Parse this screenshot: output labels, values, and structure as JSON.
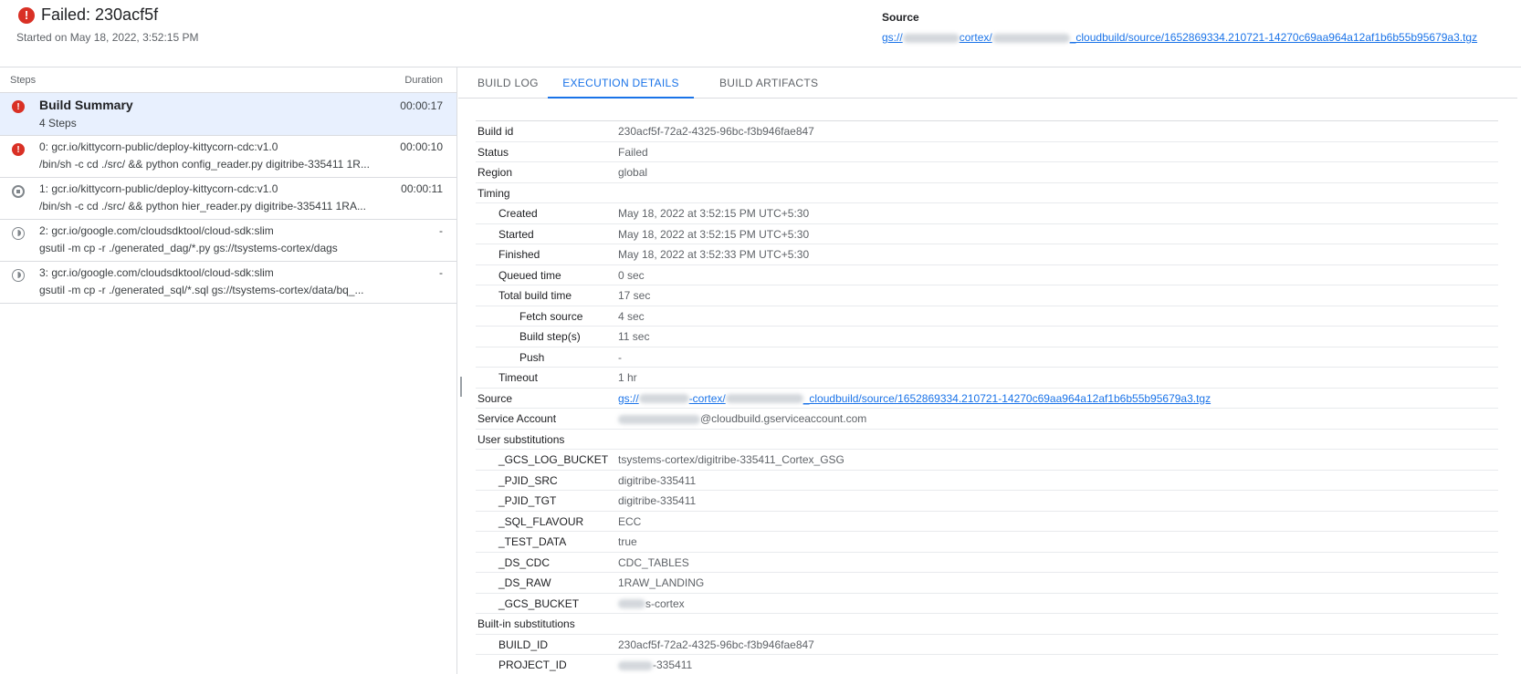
{
  "header": {
    "title": "Failed: 230acf5f",
    "started": "Started on May 18, 2022, 3:52:15 PM",
    "source_label": "Source",
    "source_link_prefix": "gs://",
    "source_link_mid": "cortex/",
    "source_link_tail": "_cloudbuild/source/1652869334.210721-14270c69aa964a12af1b6b55b95679a3.tgz"
  },
  "steps_panel": {
    "col_steps": "Steps",
    "col_duration": "Duration",
    "steps": [
      {
        "title": "Build Summary",
        "subtitle": "4 Steps",
        "duration": "00:00:17",
        "status": "error"
      },
      {
        "title": "0: gcr.io/kittycorn-public/deploy-kittycorn-cdc:v1.0",
        "subtitle": "/bin/sh -c cd ./src/ && python config_reader.py digitribe-335411 1R...",
        "duration": "00:00:10",
        "status": "error"
      },
      {
        "title": "1: gcr.io/kittycorn-public/deploy-kittycorn-cdc:v1.0",
        "subtitle": "/bin/sh -c cd ./src/ && python hier_reader.py digitribe-335411 1RA...",
        "duration": "00:00:11",
        "status": "cancelled"
      },
      {
        "title": "2: gcr.io/google.com/cloudsdktool/cloud-sdk:slim",
        "subtitle": "gsutil -m cp -r ./generated_dag/*.py gs://tsystems-cortex/dags",
        "duration": "-",
        "status": "pending"
      },
      {
        "title": "3: gcr.io/google.com/cloudsdktool/cloud-sdk:slim",
        "subtitle": "gsutil -m cp -r ./generated_sql/*.sql gs://tsystems-cortex/data/bq_...",
        "duration": "-",
        "status": "pending"
      }
    ]
  },
  "tabs": [
    "BUILD LOG",
    "EXECUTION DETAILS",
    "BUILD ARTIFACTS"
  ],
  "details": [
    {
      "k": "Build id",
      "v": "230acf5f-72a2-4325-96bc-f3b946fae847",
      "level": 0
    },
    {
      "k": "Status",
      "v": "Failed",
      "level": 0
    },
    {
      "k": "Region",
      "v": "global",
      "level": 0
    },
    {
      "k": "Timing",
      "v": "",
      "level": 0
    },
    {
      "k": "Created",
      "v": "May 18, 2022 at 3:52:15 PM UTC+5:30",
      "level": 1
    },
    {
      "k": "Started",
      "v": "May 18, 2022 at 3:52:15 PM UTC+5:30",
      "level": 1
    },
    {
      "k": "Finished",
      "v": "May 18, 2022 at 3:52:33 PM UTC+5:30",
      "level": 1
    },
    {
      "k": "Queued time",
      "v": "0 sec",
      "level": 1
    },
    {
      "k": "Total build time",
      "v": "17 sec",
      "level": 1
    },
    {
      "k": "Fetch source",
      "v": "4 sec",
      "level": 2
    },
    {
      "k": "Build step(s)",
      "v": "11 sec",
      "level": 2
    },
    {
      "k": "Push",
      "v": "-",
      "level": 2
    },
    {
      "k": "Timeout",
      "v": "1 hr",
      "level": 1
    },
    {
      "k": "Source",
      "v": "_cloudbuild/source/1652869334.210721-14270c69aa964a12af1b6b55b95679a3.tgz",
      "level": 0,
      "link": true
    },
    {
      "k": "Service Account",
      "v": "@cloudbuild.gserviceaccount.com",
      "level": 0,
      "redacted": true
    },
    {
      "k": "User substitutions",
      "v": "",
      "level": 0
    },
    {
      "k": "_GCS_LOG_BUCKET",
      "v": "tsystems-cortex/digitribe-335411_Cortex_GSG",
      "level": 1
    },
    {
      "k": "_PJID_SRC",
      "v": "digitribe-335411",
      "level": 1
    },
    {
      "k": "_PJID_TGT",
      "v": "digitribe-335411",
      "level": 1
    },
    {
      "k": "_SQL_FLAVOUR",
      "v": "ECC",
      "level": 1
    },
    {
      "k": "_TEST_DATA",
      "v": "true",
      "level": 1
    },
    {
      "k": "_DS_CDC",
      "v": "CDC_TABLES",
      "level": 1
    },
    {
      "k": "_DS_RAW",
      "v": "1RAW_LANDING",
      "level": 1
    },
    {
      "k": "_GCS_BUCKET",
      "v": "s-cortex",
      "level": 1,
      "redacted": true
    },
    {
      "k": "Built-in substitutions",
      "v": "",
      "level": 0
    },
    {
      "k": "BUILD_ID",
      "v": "230acf5f-72a2-4325-96bc-f3b946fae847",
      "level": 1
    },
    {
      "k": "PROJECT_ID",
      "v": "-335411",
      "level": 1,
      "redacted": true
    }
  ]
}
